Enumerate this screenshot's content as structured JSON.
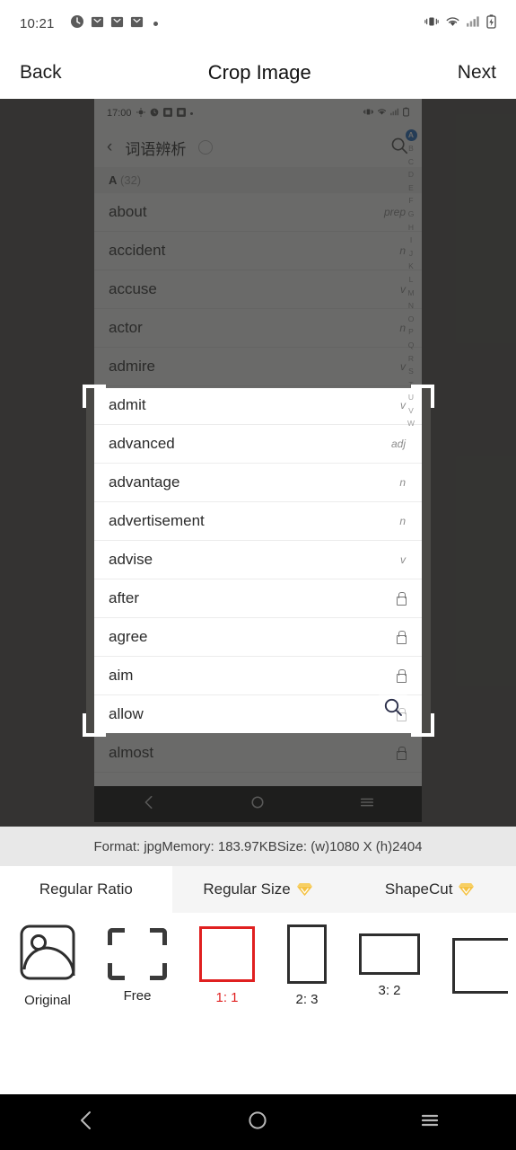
{
  "status_bar": {
    "time": "10:21",
    "left_icons": [
      "clock-icon",
      "mail-icon",
      "mail-icon",
      "mail-icon",
      "dot-icon"
    ],
    "right_icons": [
      "vibrate-icon",
      "wifi-icon",
      "signal-icon",
      "battery-charging-icon"
    ]
  },
  "header": {
    "back_label": "Back",
    "title": "Crop Image",
    "next_label": "Next"
  },
  "photo": {
    "status_time": "17:00",
    "nav_title": "词语辨析",
    "section_letter": "A",
    "section_count": "(32)",
    "words_above": [
      {
        "word": "about",
        "pos": "prep"
      },
      {
        "word": "accident",
        "pos": "n"
      },
      {
        "word": "accuse",
        "pos": "v"
      }
    ],
    "words_in_crop": [
      {
        "word": "actor",
        "pos": "n"
      },
      {
        "word": "admire",
        "pos": "v"
      },
      {
        "word": "admit",
        "pos": "v"
      },
      {
        "word": "advanced",
        "pos": "adj"
      },
      {
        "word": "advantage",
        "pos": "n"
      },
      {
        "word": "advertisement",
        "pos": "n"
      },
      {
        "word": "advise",
        "pos": "v"
      },
      {
        "word": "after",
        "pos": "lock"
      }
    ],
    "words_below": [
      {
        "word": "agree",
        "pos": "lock"
      },
      {
        "word": "aim",
        "pos": "lock"
      },
      {
        "word": "allow",
        "pos": "lock"
      },
      {
        "word": "almost",
        "pos": "lock"
      }
    ],
    "alphabet_selected": "A",
    "alphabet": [
      "B",
      "C",
      "D",
      "E",
      "F",
      "G",
      "H",
      "I",
      "J",
      "K",
      "L",
      "M",
      "N",
      "O",
      "P",
      "Q",
      "R",
      "S",
      "T",
      "U",
      "V",
      "W"
    ],
    "accent_selected": "#1565c0"
  },
  "info_bar": {
    "text": "Format: jpgMemory: 183.97KBSize: (w)1080 X (h)2404"
  },
  "tabs": [
    {
      "label": "Regular Ratio",
      "active": true,
      "badge": false
    },
    {
      "label": "Regular Size",
      "active": false,
      "badge": true
    },
    {
      "label": "ShapeCut",
      "active": false,
      "badge": true
    }
  ],
  "ratios": [
    {
      "label": "Original",
      "selected": false,
      "icon": "image-icon"
    },
    {
      "label": "Free",
      "selected": false,
      "icon": "free-crop-icon"
    },
    {
      "label": "1: 1",
      "selected": true,
      "icon": "square-icon"
    },
    {
      "label": "2: 3",
      "selected": false,
      "icon": "portrait-icon"
    },
    {
      "label": "3: 2",
      "selected": false,
      "icon": "landscape-icon"
    }
  ],
  "colors": {
    "selected": "#e02020",
    "badge": "#f5c242",
    "canvas": "#4a4946",
    "info_bar": "#e8e8e8"
  },
  "system_nav": {
    "back": "back-icon",
    "home": "home-icon",
    "recents": "recents-icon"
  }
}
